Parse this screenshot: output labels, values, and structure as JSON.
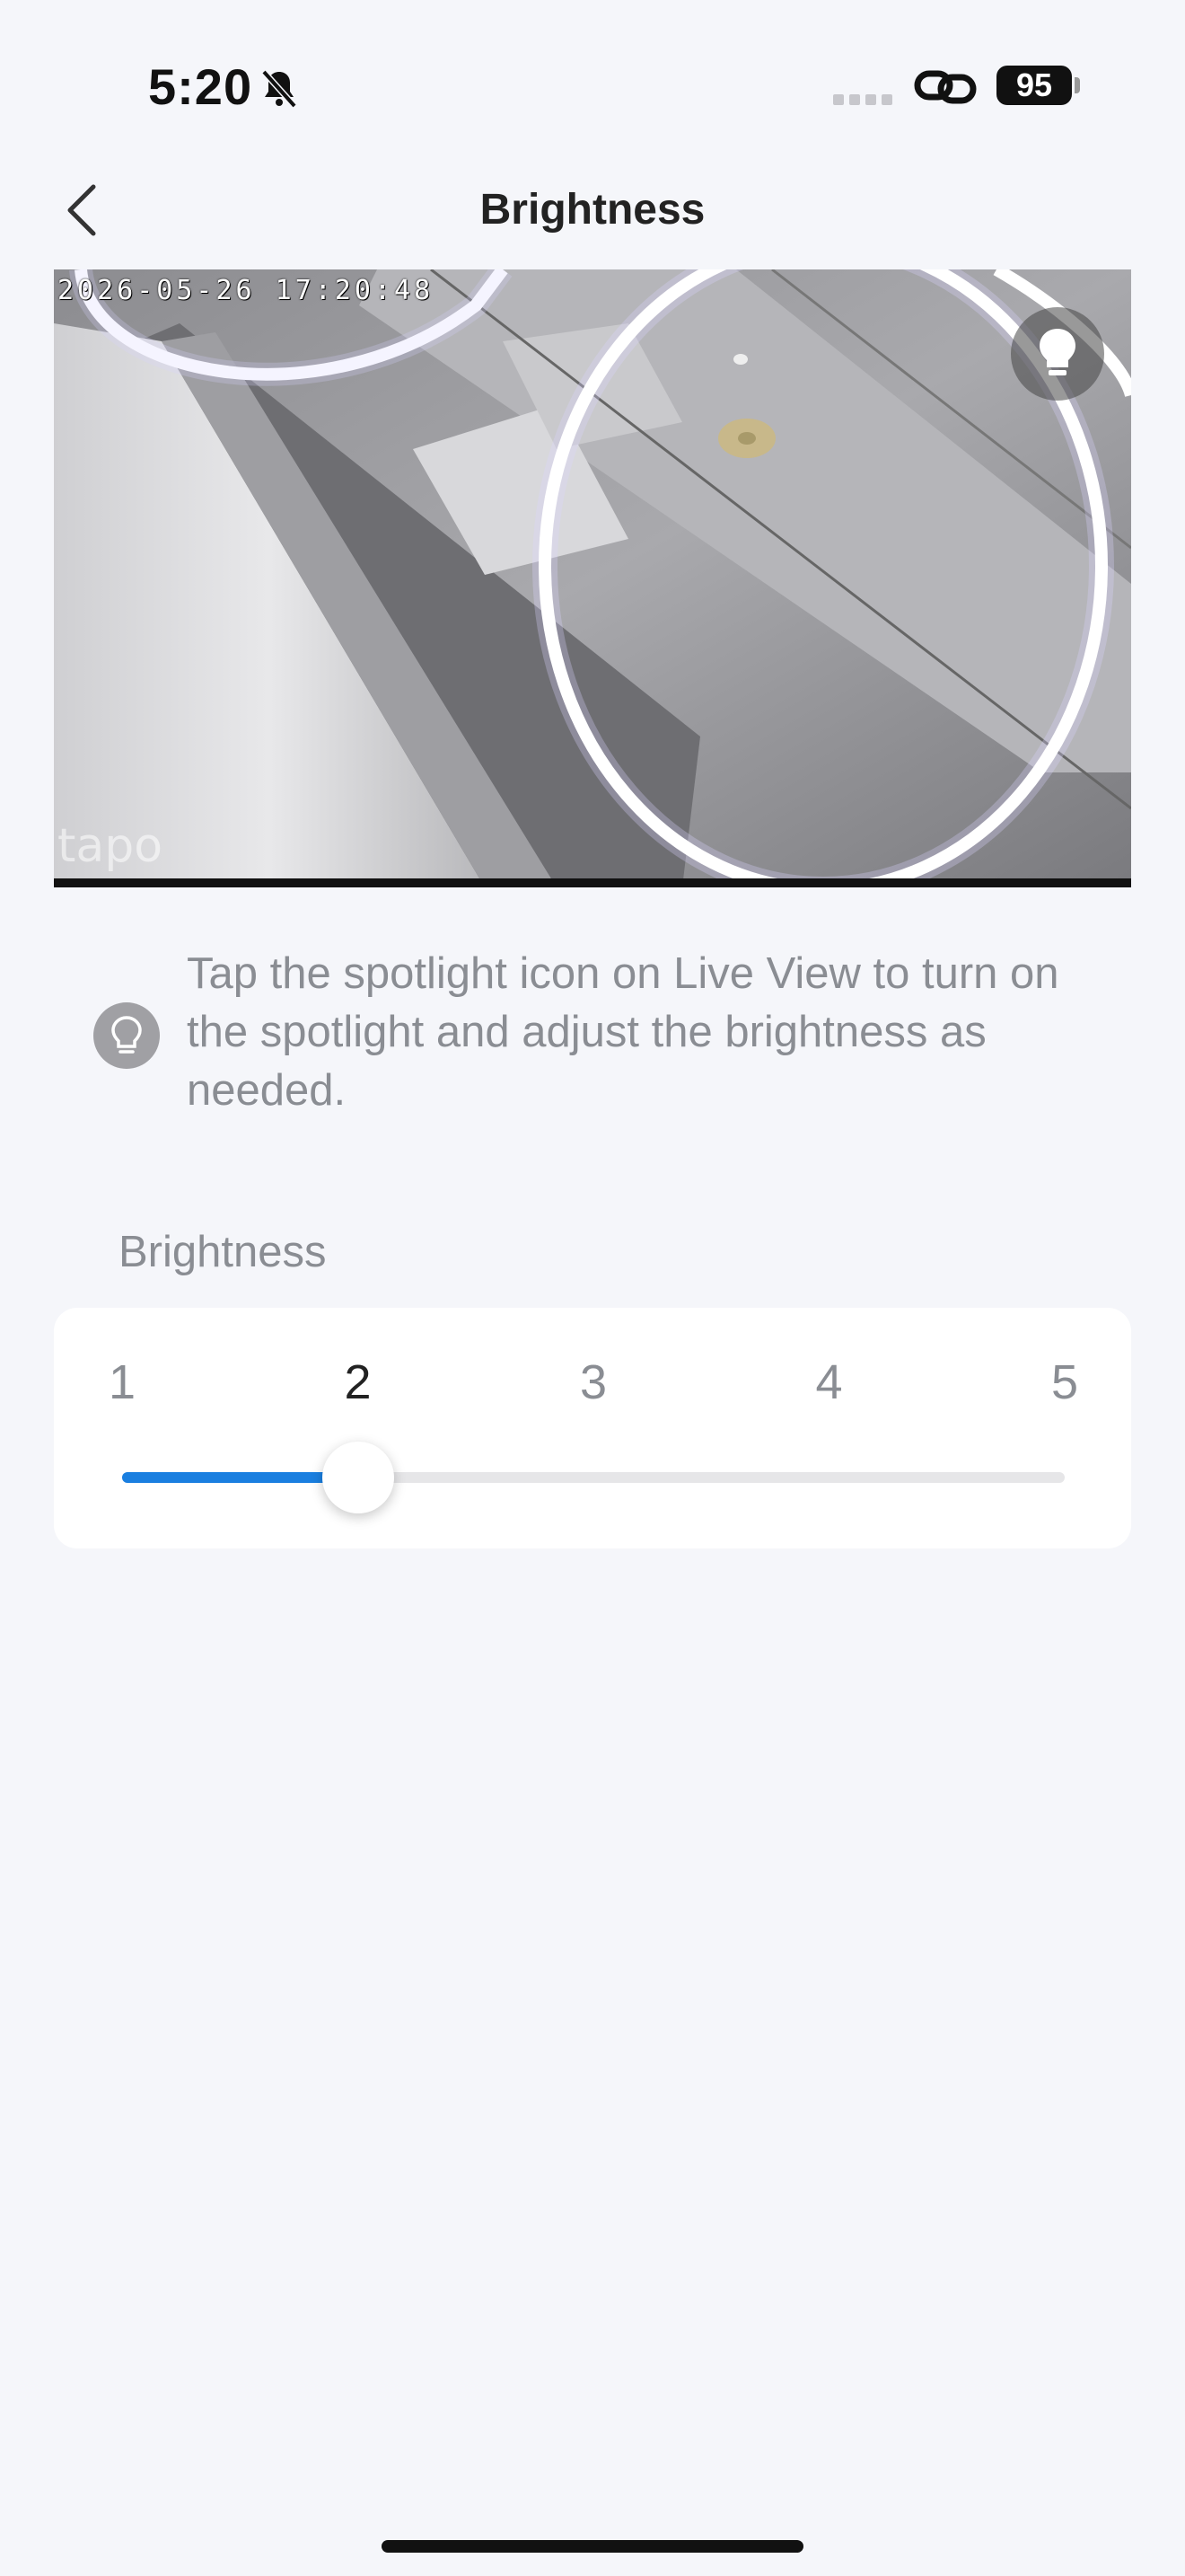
{
  "status_bar": {
    "time": "5:20",
    "battery": "95",
    "icons": [
      "bell-slash-icon",
      "signal-icon",
      "link-icon",
      "battery-icon"
    ]
  },
  "header": {
    "title": "Brightness",
    "back_icon": "chevron-left-icon"
  },
  "camera": {
    "timestamp": "2026-05-26 17:20:48",
    "watermark": "tapo",
    "spotlight_icon": "bulb-icon"
  },
  "tip": {
    "icon": "bulb-outline-icon",
    "text": "Tap the spotlight icon on Live View to turn on the spotlight and adjust the brightness as needed."
  },
  "brightness": {
    "label": "Brightness",
    "levels": [
      "1",
      "2",
      "3",
      "4",
      "5"
    ],
    "selected": 2,
    "accent_color": "#1a7fe0"
  }
}
